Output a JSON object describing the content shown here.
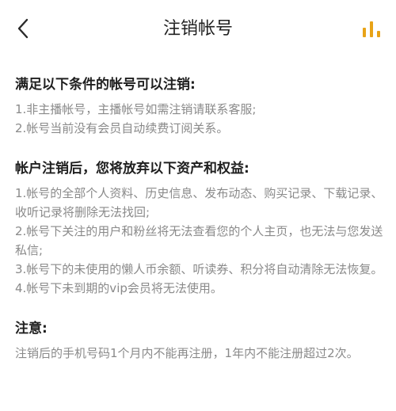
{
  "header": {
    "title": "注销帐号",
    "back_icon": "chevron-left-icon",
    "right_icon": "bar-chart-icon",
    "accent_color": "#E8A317"
  },
  "sections": {
    "conditions": {
      "heading": "满足以下条件的帐号可以注销:",
      "items": [
        "1.非主播帐号，主播帐号如需注销请联系客服;",
        "2.帐号当前没有会员自动续费订阅关系。"
      ]
    },
    "rights": {
      "heading": "帐户注销后，您将放弃以下资产和权益:",
      "items": [
        "1.帐号的全部个人资料、历史信息、发布动态、购买记录、下载记录、收听记录将删除无法找回;",
        "2.帐号下关注的用户和粉丝将无法查看您的个人主页，也无法与您发送私信;",
        "3.帐号下的未使用的懒人币余额、听读券、积分将自动清除无法恢复。",
        "4.帐号下未到期的vip会员将无法使用。"
      ]
    },
    "note": {
      "heading": "注意:",
      "text": "注销后的手机号码1个月内不能再注册，1年内不能注册超过2次。"
    }
  }
}
